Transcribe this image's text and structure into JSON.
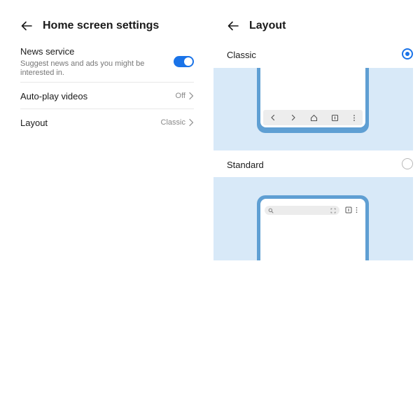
{
  "home": {
    "title": "Home screen settings",
    "news": {
      "title": "News service",
      "subtitle": "Suggest news and ads you might be interested in.",
      "enabled": true
    },
    "autoplay": {
      "title": "Auto-play videos",
      "value": "Off"
    },
    "layout": {
      "title": "Layout",
      "value": "Classic"
    }
  },
  "layout_page": {
    "title": "Layout",
    "options": [
      {
        "label": "Classic",
        "selected": true
      },
      {
        "label": "Standard",
        "selected": false
      }
    ]
  },
  "colors": {
    "accent": "#1a73e8",
    "preview_bg": "#d8e9f8",
    "phone_frame": "#5f9fd3"
  }
}
